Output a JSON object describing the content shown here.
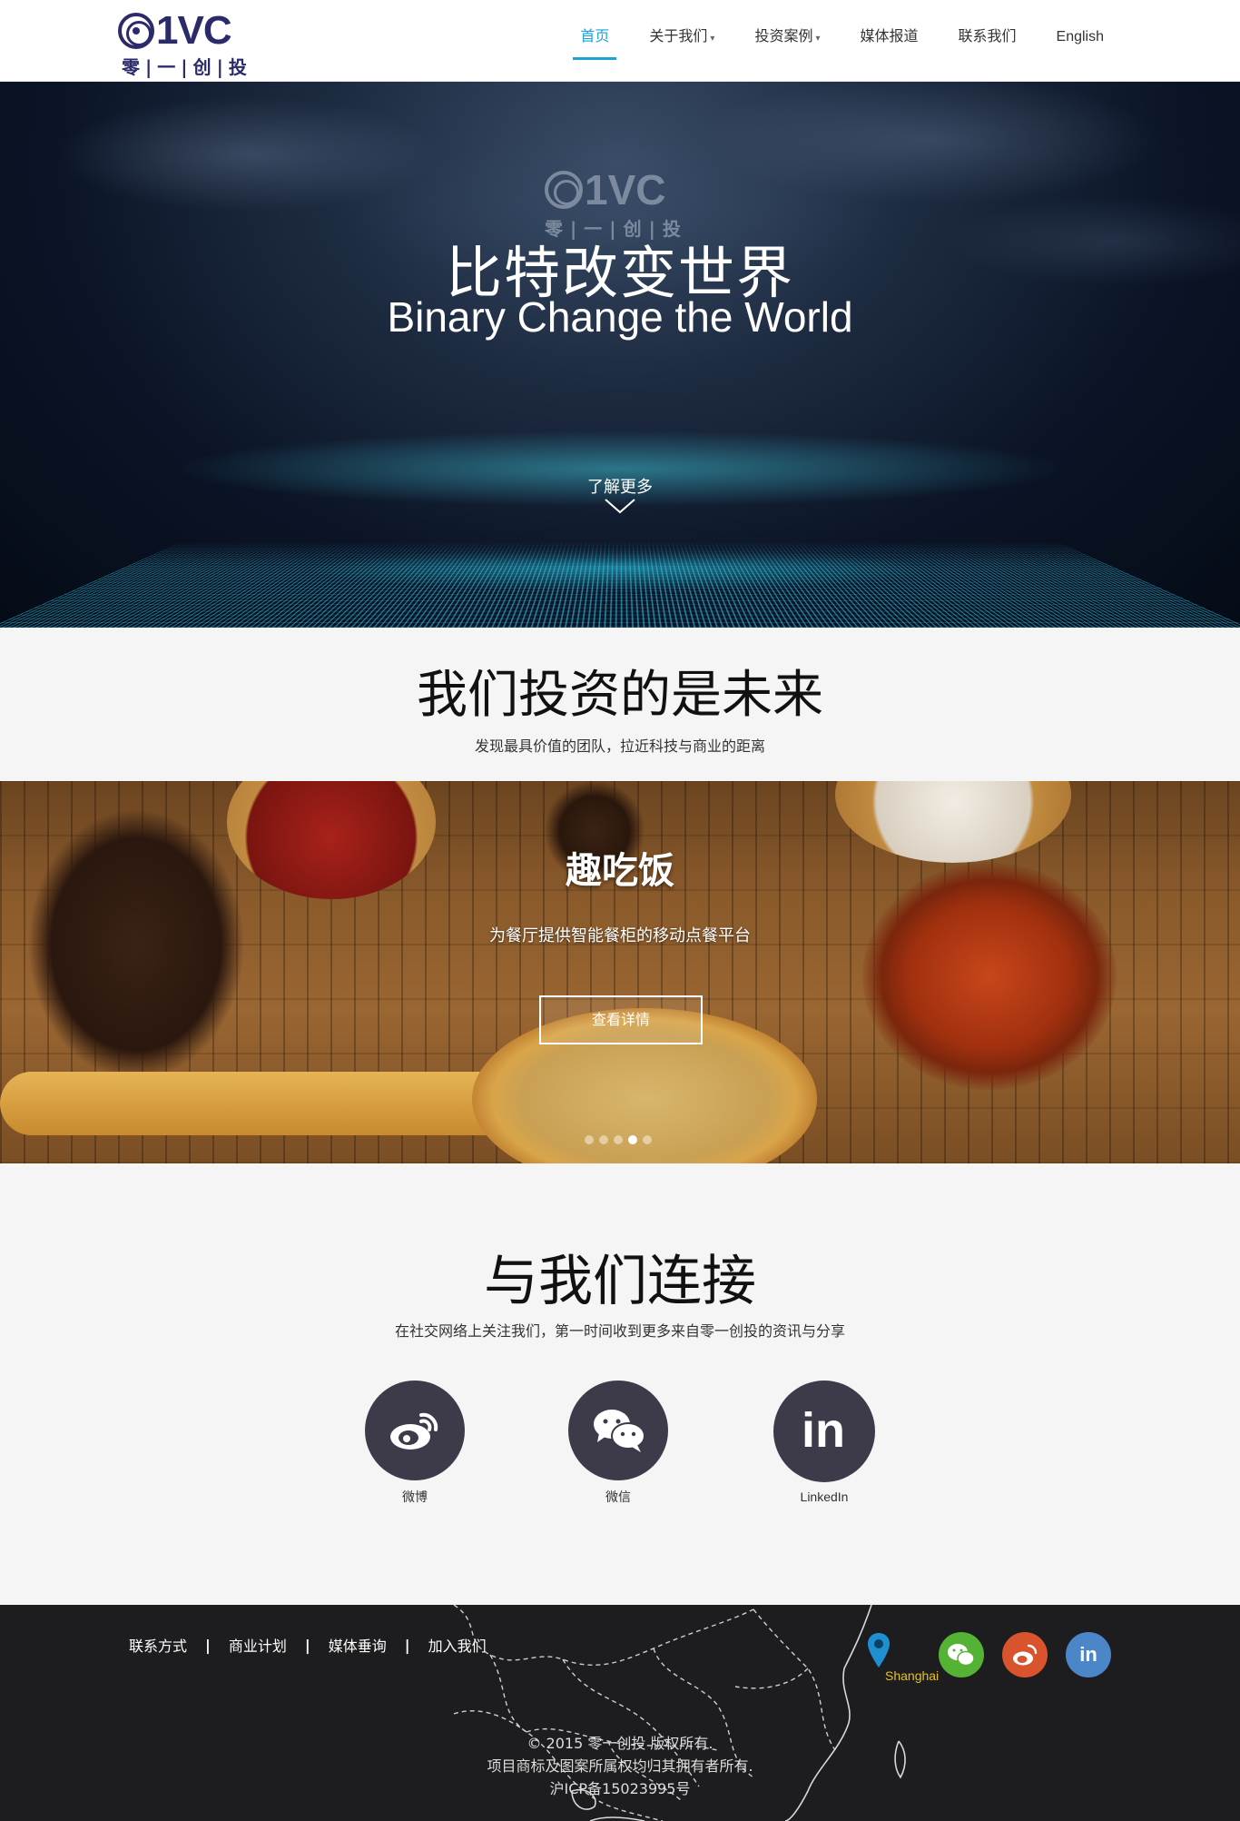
{
  "header": {
    "logo": {
      "mark": "VC",
      "sub": "零|一|创|投"
    },
    "nav": [
      {
        "label": "首页",
        "active": true,
        "dropdown": false
      },
      {
        "label": "关于我们",
        "active": false,
        "dropdown": true
      },
      {
        "label": "投资案例",
        "active": false,
        "dropdown": true
      },
      {
        "label": "媒体报道",
        "active": false,
        "dropdown": false
      },
      {
        "label": "联系我们",
        "active": false,
        "dropdown": false
      },
      {
        "label": "English",
        "active": false,
        "dropdown": false
      }
    ],
    "caret": "▾"
  },
  "hero": {
    "logo_mark": "VC",
    "logo_sub": "零|一|创|投",
    "title_cn": "比特改变世界",
    "title_en": "Binary Change the World",
    "more": "了解更多",
    "chevron_icon": "chevron-down-icon"
  },
  "invest": {
    "title": "我们投资的是未来",
    "subtitle": "发现最具价值的团队，拉近科技与商业的距离"
  },
  "carousel": {
    "slide_title": "趣吃饭",
    "slide_subtitle": "为餐厅提供智能餐柜的移动点餐平台",
    "button": "查看详情",
    "dots": 5,
    "active_dot": 3
  },
  "connect": {
    "title": "与我们连接",
    "subtitle": "在社交网络上关注我们，第一时间收到更多来自零一创投的资讯与分享",
    "items": [
      {
        "label": "微博",
        "icon": "weibo-icon"
      },
      {
        "label": "微信",
        "icon": "wechat-icon"
      },
      {
        "label": "LinkedIn",
        "icon": "linkedin-icon"
      }
    ]
  },
  "footer": {
    "links": [
      "联系方式",
      "商业计划",
      "媒体垂询",
      "加入我们"
    ],
    "separator": "|",
    "map_label": "Shanghai",
    "copyright": "© 2015 零一创投 版权所有.",
    "trademark": "项目商标及图案所属权均归其拥有者所有.",
    "icp": "沪ICP备15023995号",
    "social": [
      "wechat-icon",
      "weibo-icon",
      "linkedin-icon"
    ],
    "linkedin_text": "in"
  },
  "colors": {
    "accent": "#1aa3d9",
    "logo": "#2b2b6b",
    "social_circle": "#3d3a4a",
    "footer_bg": "#1d1d1f",
    "wechat": "#54b234",
    "weibo": "#d9542c",
    "linkedin": "#4a86c8"
  }
}
